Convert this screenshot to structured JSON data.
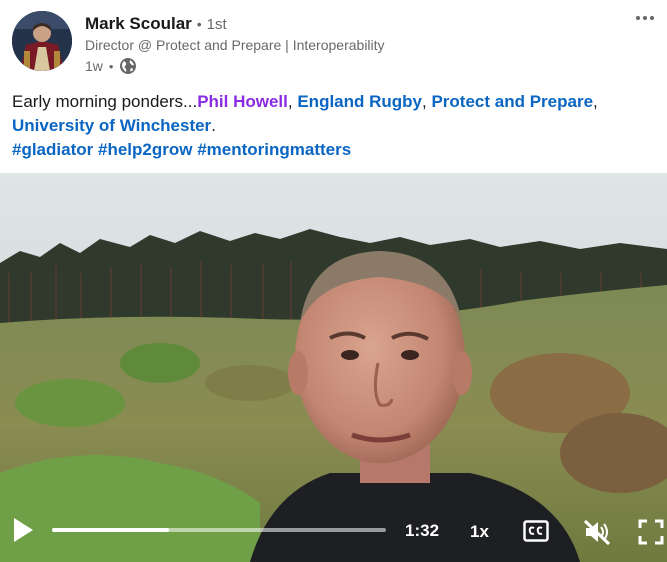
{
  "post": {
    "author": "Mark Scoular",
    "degree": "1st",
    "headline": "Director @ Protect and Prepare | Interoperability",
    "time": "1w",
    "visibility_icon": "globe-icon",
    "more_icon": "more-icon"
  },
  "text": {
    "intro": "Early morning ponders...",
    "mention_1": "Phil Howell",
    "sep_1": ", ",
    "mention_2": "England Rugby",
    "sep_2": ", ",
    "mention_3": "Protect and Prepare",
    "sep_3": ", ",
    "mention_4": "University of Winchester",
    "end": ".",
    "hashtag_1": "#gladiator",
    "hashtag_2": "#help2grow",
    "hashtag_3": "#mentoringmatters"
  },
  "video": {
    "time": "1:32",
    "speed": "1x",
    "progress": 0.35,
    "icons": [
      "play-icon",
      "captions-icon",
      "muted-icon",
      "fullscreen-icon"
    ]
  },
  "colors": {
    "link": "#0a66c2",
    "visited_link": "#8a2be2",
    "secondary_text": "#666666"
  }
}
